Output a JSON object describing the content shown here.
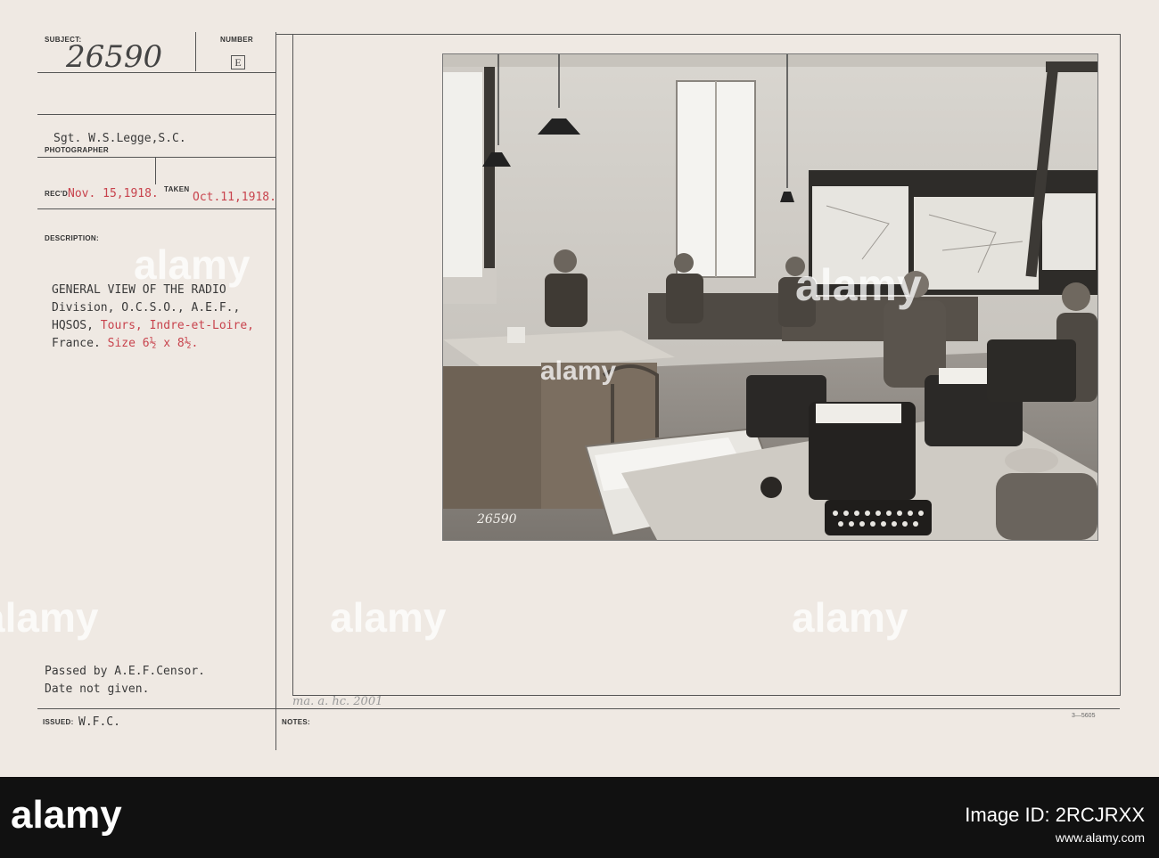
{
  "card": {
    "subject_label": "SUBJECT:",
    "subject_value": "26590",
    "number_label": "NUMBER",
    "number_value": "E",
    "photographer_value": "Sgt. W.S.Legge,S.C.",
    "photographer_label": "PHOTOGRAPHER",
    "recd_label": "REC'D",
    "recd_value": "Nov. 15,1918.",
    "taken_label": "TAKEN",
    "taken_value": "Oct.11,1918.",
    "description_label": "DESCRIPTION:",
    "description_lines": [
      "GENERAL VIEW OF THE RADIO",
      "Division, O.C.S.O., A.E.F.,",
      "HQSOS, ",
      "France. "
    ],
    "description_red": {
      "line3": "Tours, Indre-et-Loire,",
      "line4": "Size 6½ x 8½."
    },
    "censor_lines": [
      "Passed by A.E.F.Censor.",
      "Date not given."
    ],
    "issued_label": "ISSUED:",
    "issued_value": "W.F.C.",
    "notes_label": "NOTES:",
    "notes_handwriting": "ma. a. hc. 2001",
    "stamp_number": "26590",
    "corner_code": "3—5605"
  },
  "watermark": "alamy",
  "footer": {
    "logo": "alamy",
    "image_id": "Image ID: 2RCJRXX",
    "site": "www.alamy.com"
  },
  "colors": {
    "card": "#efe9e3",
    "ink": "#3a3a3a",
    "red_ink": "#c8434d",
    "footer": "#111111"
  }
}
